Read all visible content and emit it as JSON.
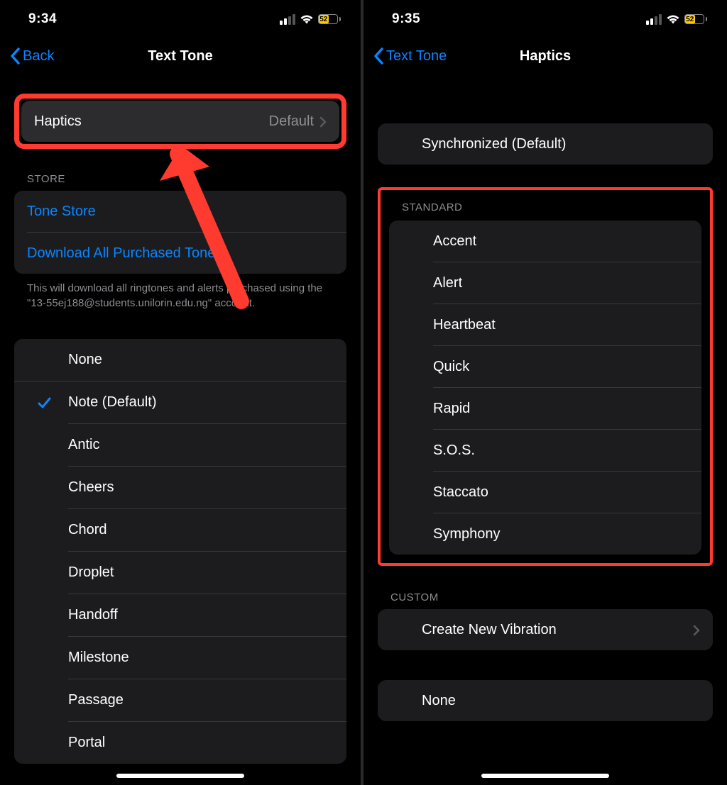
{
  "left": {
    "status": {
      "time": "9:34",
      "battery": "52"
    },
    "nav": {
      "back": "Back",
      "title": "Text Tone"
    },
    "haptics": {
      "label": "Haptics",
      "value": "Default"
    },
    "store": {
      "header": "STORE",
      "tone_store": "Tone Store",
      "download": "Download All Purchased Tones",
      "footer": "This will download all ringtones and alerts purchased using the \"13-55ej188@students.unilorin.edu.ng\" account."
    },
    "tones": {
      "none": "None",
      "selected_index": 0,
      "items": [
        "Note (Default)",
        "Antic",
        "Cheers",
        "Chord",
        "Droplet",
        "Handoff",
        "Milestone",
        "Passage",
        "Portal"
      ]
    }
  },
  "right": {
    "status": {
      "time": "9:35",
      "battery": "52"
    },
    "nav": {
      "back": "Text Tone",
      "title": "Haptics"
    },
    "sync": "Synchronized (Default)",
    "standard": {
      "header": "STANDARD",
      "items": [
        "Accent",
        "Alert",
        "Heartbeat",
        "Quick",
        "Rapid",
        "S.O.S.",
        "Staccato",
        "Symphony"
      ]
    },
    "custom": {
      "header": "CUSTOM",
      "create": "Create New Vibration"
    },
    "none": "None"
  }
}
